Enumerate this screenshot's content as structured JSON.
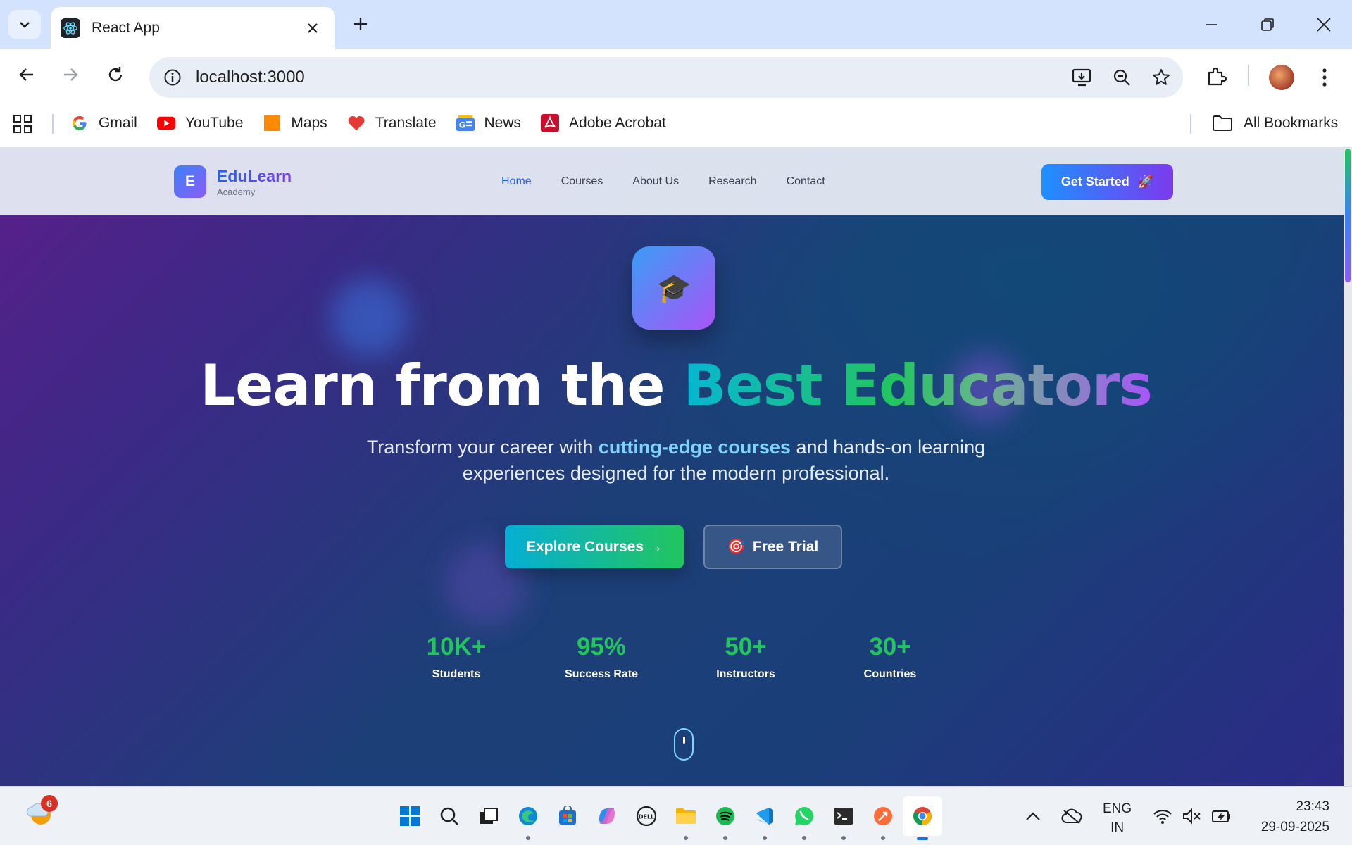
{
  "browser": {
    "tab_title": "React App",
    "url": "localhost:3000",
    "bookmarks": [
      {
        "label": "Gmail",
        "icon": "gmail-icon"
      },
      {
        "label": "YouTube",
        "icon": "youtube-icon"
      },
      {
        "label": "Maps",
        "icon": "maps-icon"
      },
      {
        "label": "Translate",
        "icon": "translate-icon"
      },
      {
        "label": "News",
        "icon": "news-icon"
      },
      {
        "label": "Adobe Acrobat",
        "icon": "acrobat-icon"
      }
    ],
    "all_bookmarks": "All Bookmarks"
  },
  "site": {
    "logo_letter": "E",
    "brand": "EduLearn",
    "brand_sub": "Academy",
    "nav": [
      "Home",
      "Courses",
      "About Us",
      "Research",
      "Contact"
    ],
    "active_nav": "Home",
    "cta": "Get Started",
    "cta_icon": "🚀"
  },
  "hero": {
    "icon": "🎓",
    "headline_plain": "Learn from the ",
    "headline_accent": "Best Educators",
    "sub_before": "Transform your career with ",
    "sub_highlight": "cutting-edge courses",
    "sub_after": " and hands-on learning experiences designed for the modern professional.",
    "primary_button": "Explore Courses →",
    "secondary_button": "Free Trial",
    "secondary_icon": "🎯",
    "stats": [
      {
        "value": "10K+",
        "label": "Students"
      },
      {
        "value": "95%",
        "label": "Success Rate"
      },
      {
        "value": "50+",
        "label": "Instructors"
      },
      {
        "value": "30+",
        "label": "Countries"
      }
    ]
  },
  "taskbar": {
    "weather_badge": "6",
    "lang_line1": "ENG",
    "lang_line2": "IN",
    "time": "23:43",
    "date": "29-09-2025"
  },
  "colors": {
    "accent": "#2563eb",
    "brand_gradient_start": "#3b82f6",
    "brand_gradient_end": "#8b5cf6",
    "stat_green": "#22c55e"
  }
}
